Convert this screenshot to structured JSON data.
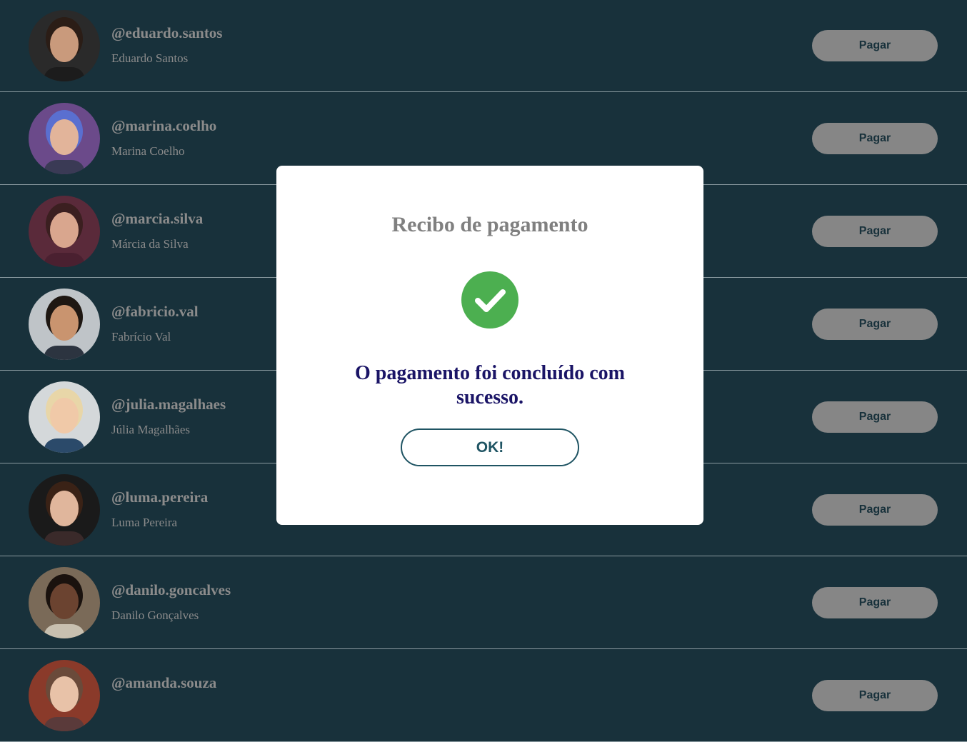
{
  "contacts": [
    {
      "handle": "@eduardo.santos",
      "name": "Eduardo Santos",
      "button": "Pagar",
      "avatar": {
        "bg": "#2a2a2a",
        "skin": "#c99a7c",
        "hair": "#2b1d16",
        "shirt": "#1c1c1c"
      }
    },
    {
      "handle": "@marina.coelho",
      "name": "Marina Coelho",
      "button": "Pagar",
      "avatar": {
        "bg": "#6b4a8a",
        "skin": "#e2b49a",
        "hair": "#5a6fd0",
        "shirt": "#3a3a55"
      }
    },
    {
      "handle": "@marcia.silva",
      "name": "Márcia da Silva",
      "button": "Pagar",
      "avatar": {
        "bg": "#5a2a3a",
        "skin": "#d9a68e",
        "hair": "#3b1f20",
        "shirt": "#4a2030"
      }
    },
    {
      "handle": "@fabricio.val",
      "name": "Fabrício Val",
      "button": "Pagar",
      "avatar": {
        "bg": "#bfc4c8",
        "skin": "#c9946f",
        "hair": "#1e1712",
        "shirt": "#2c3440"
      }
    },
    {
      "handle": "@julia.magalhaes",
      "name": "Júlia Magalhães",
      "button": "Pagar",
      "avatar": {
        "bg": "#d4d8da",
        "skin": "#f0c9a8",
        "hair": "#e8d6a8",
        "shirt": "#2b4a6a"
      }
    },
    {
      "handle": "@luma.pereira",
      "name": "Luma Pereira",
      "button": "Pagar",
      "avatar": {
        "bg": "#1a1a1a",
        "skin": "#e0b69c",
        "hair": "#3a2216",
        "shirt": "#3a2a2a"
      }
    },
    {
      "handle": "@danilo.goncalves",
      "name": "Danilo Gonçalves",
      "button": "Pagar",
      "avatar": {
        "bg": "#7a6a58",
        "skin": "#6b4330",
        "hair": "#1a120e",
        "shirt": "#c8c0b0"
      }
    },
    {
      "handle": "@amanda.souza",
      "name": "",
      "button": "Pagar",
      "avatar": {
        "bg": "#8a3a2a",
        "skin": "#e8c2a8",
        "hair": "#6a4a3a",
        "shirt": "#5a3a3a"
      }
    }
  ],
  "modal": {
    "title": "Recibo de pagamento",
    "message": "O pagamento foi concluído com sucesso.",
    "ok_label": "OK!",
    "icon": "check-circle-icon",
    "success_color": "#4caf50"
  },
  "colors": {
    "background": "#18313b",
    "button": "#868686",
    "accent": "#1f5463",
    "message": "#1a1466"
  }
}
